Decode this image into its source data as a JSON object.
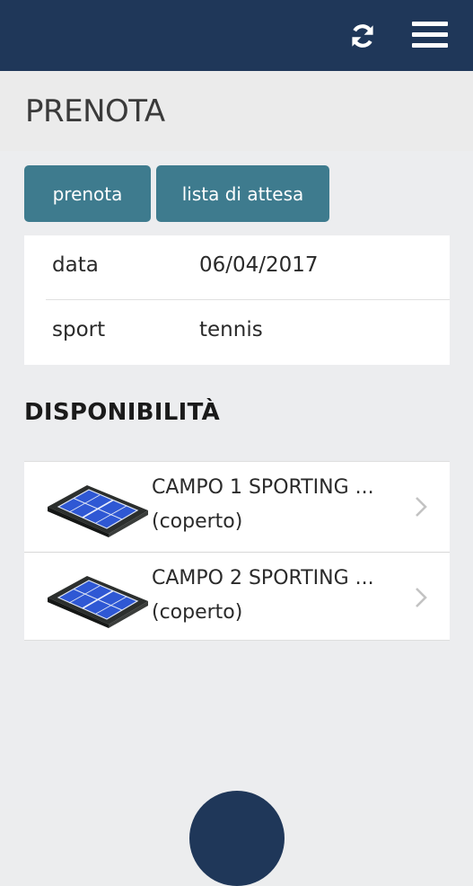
{
  "topbar": {
    "refresh_icon": "refresh-icon",
    "menu_icon": "hamburger-menu-icon",
    "background_color": "#1f3759"
  },
  "page": {
    "title": "PRENOTA"
  },
  "tabs": [
    {
      "label": "prenota"
    },
    {
      "label": "lista di attesa"
    }
  ],
  "tab_color": "#3e7b8e",
  "form": {
    "rows": [
      {
        "label": "data",
        "value": "06/04/2017"
      },
      {
        "label": "sport",
        "value": "tennis"
      }
    ]
  },
  "availability": {
    "title": "DISPONIBILITÀ",
    "items": [
      {
        "title": "CAMPO 1 SPORTING ...",
        "subtitle": "(coperto)",
        "icon": "tennis-court-icon"
      },
      {
        "title": "CAMPO 2 SPORTING ...",
        "subtitle": "(coperto)",
        "icon": "tennis-court-icon"
      }
    ]
  }
}
